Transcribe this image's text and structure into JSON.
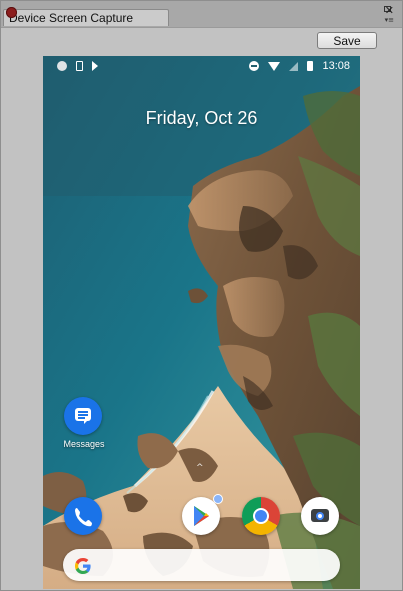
{
  "window": {
    "tab_title": "Device Screen Capture",
    "close_glyph": "✕",
    "menu_glyph": "▾≡"
  },
  "toolbar": {
    "save_label": "Save"
  },
  "device": {
    "status_bar": {
      "time": "13:08",
      "left_icons": [
        "notification-dot-icon",
        "phone-status-icon",
        "flag-icon"
      ],
      "right_icons": [
        "do-not-disturb-icon",
        "wifi-icon",
        "no-signal-icon",
        "battery-icon"
      ]
    },
    "date": "Friday, Oct 26",
    "home_apps": [
      {
        "name": "Messages",
        "label": "Messages"
      }
    ],
    "dock_apps": [
      {
        "name": "Phone",
        "icon": "phone-icon"
      },
      {
        "name": "Play Store",
        "icon": "play-store-icon",
        "has_notification_dot": true
      },
      {
        "name": "Chrome",
        "icon": "chrome-icon"
      },
      {
        "name": "Camera",
        "icon": "camera-icon"
      }
    ],
    "swipe_up_glyph": "^",
    "search_bar": {
      "logo_text": "G"
    }
  }
}
